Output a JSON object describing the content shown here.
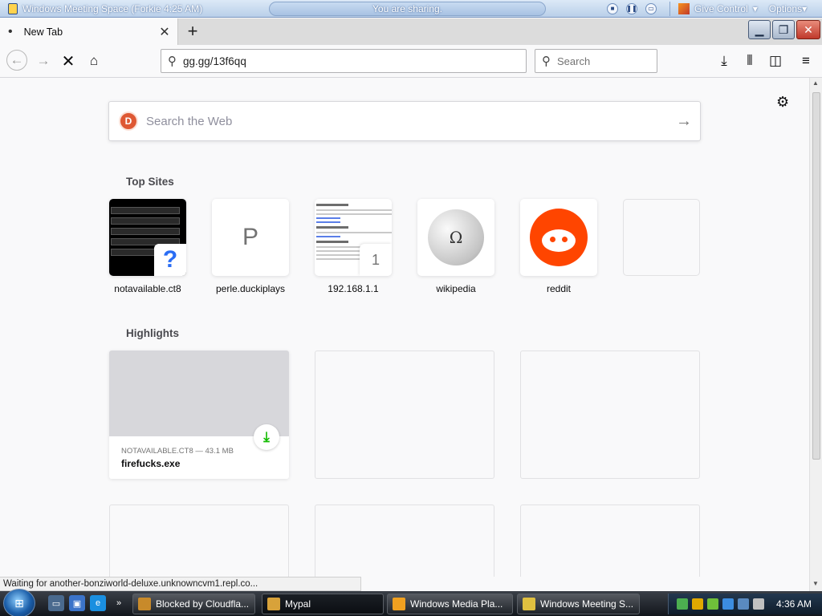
{
  "meeting_bar": {
    "title": "Windows Meeting Space (Forkie 4:25 AM)",
    "sharing": "You are sharing.",
    "give_control": "Give Control",
    "options": "Options"
  },
  "tab": {
    "label": "New Tab"
  },
  "navbar": {
    "url": "gg.gg/13f6qq",
    "search_placeholder": "Search"
  },
  "content": {
    "web_search_placeholder": "Search the Web",
    "top_sites_title": "Top Sites",
    "top_sites": [
      {
        "label": "notavailable.ct8",
        "badge": "?"
      },
      {
        "label": "perle.duckiplays",
        "letter": "P"
      },
      {
        "label": "192.168.1.1",
        "badge": "1"
      },
      {
        "label": "wikipedia",
        "glyph": "Ω"
      },
      {
        "label": "reddit"
      }
    ],
    "highlights_title": "Highlights",
    "highlight": {
      "meta": "NOTAVAILABLE.CT8 — 43.1 MB",
      "name": "firefucks.exe"
    }
  },
  "status": "Waiting for another-bonziworld-deluxe.unknowncvm1.repl.co...",
  "taskbar": {
    "items": [
      {
        "label": "Blocked by Cloudfla..."
      },
      {
        "label": "Mypal"
      },
      {
        "label": "Windows Media Pla..."
      },
      {
        "label": "Windows Meeting S..."
      }
    ],
    "clock": "4:36 AM"
  },
  "colors": {
    "accent": "#0a84ff",
    "ddg": "#de5833",
    "reddit": "#ff4500",
    "download_green": "#12bc00"
  }
}
